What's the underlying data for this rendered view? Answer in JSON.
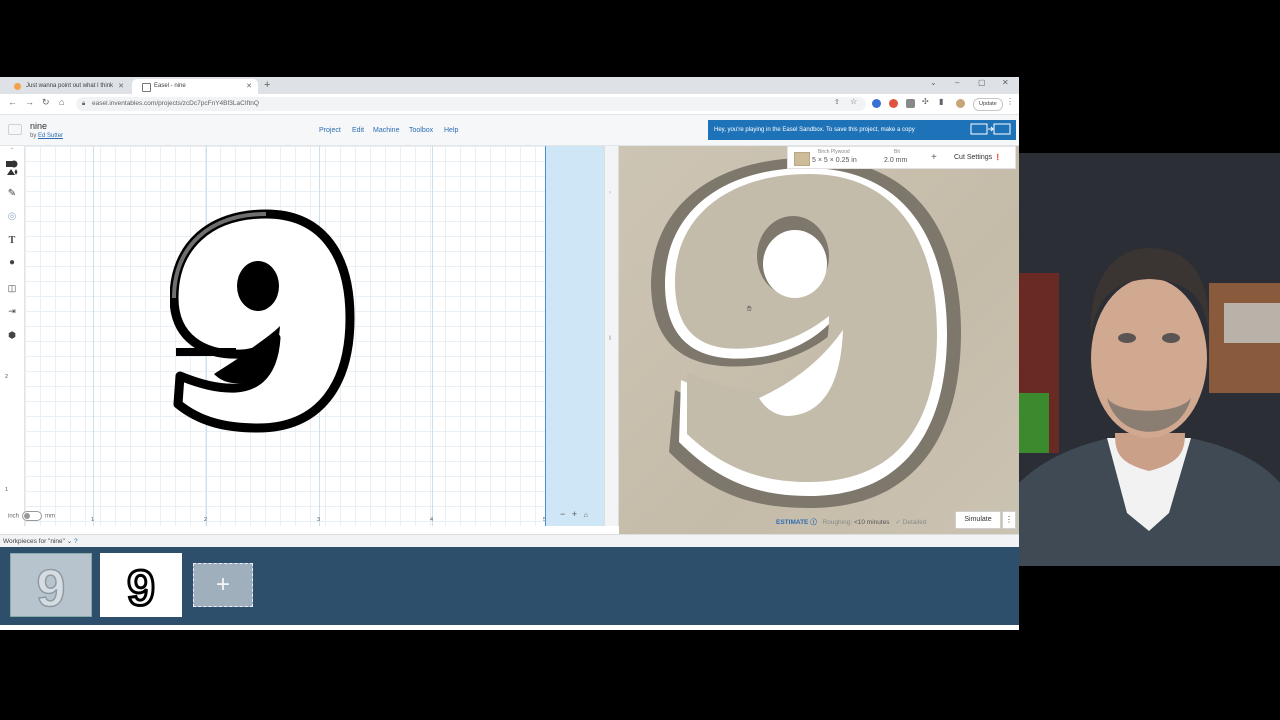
{
  "browser": {
    "tabs": [
      {
        "label": "Just wanna point out what I think"
      },
      {
        "label": "Easel - nine"
      }
    ],
    "url": "easel.inventables.com/projects/zcDc7pcFnY4Bf3LaCIftnQ",
    "update_label": "Update"
  },
  "app": {
    "project_title": "nine",
    "by_prefix": "by",
    "author": "Ed Sutter",
    "menu": [
      {
        "label": "Project"
      },
      {
        "label": "Edit"
      },
      {
        "label": "Machine"
      },
      {
        "label": "Toolbox"
      },
      {
        "label": "Help"
      }
    ],
    "banner": "Hey, you're playing in the Easel Sandbox. To save this project, make a copy"
  },
  "canvas": {
    "ruler_x": [
      "1",
      "2",
      "3",
      "4",
      "5"
    ],
    "ruler_y": [
      "2",
      "1"
    ],
    "unit_left": "inch",
    "unit_right": "mm",
    "glyph": "9"
  },
  "material": {
    "name": "Birch Plywood",
    "size": "5 × 5 × 0.25 in",
    "bit_label": "Bit",
    "bit_value": "2.0 mm",
    "cut_settings": "Cut Settings"
  },
  "status": {
    "estimate": "ESTIMATE",
    "roughing": "Roughing:",
    "time": "<10 minutes",
    "detailed": "Detailed"
  },
  "buttons": {
    "simulate": "Simulate"
  },
  "workpieces": {
    "label": "Workpieces for \"nine\"",
    "thumbs": [
      {
        "glyph": "9"
      },
      {
        "glyph": "9"
      }
    ]
  },
  "icons": {
    "shapes": "shapes-icon",
    "pen": "pen-icon",
    "text": "text-icon",
    "apps": "apple-icon",
    "import": "import-icon",
    "3d": "cube-icon"
  }
}
